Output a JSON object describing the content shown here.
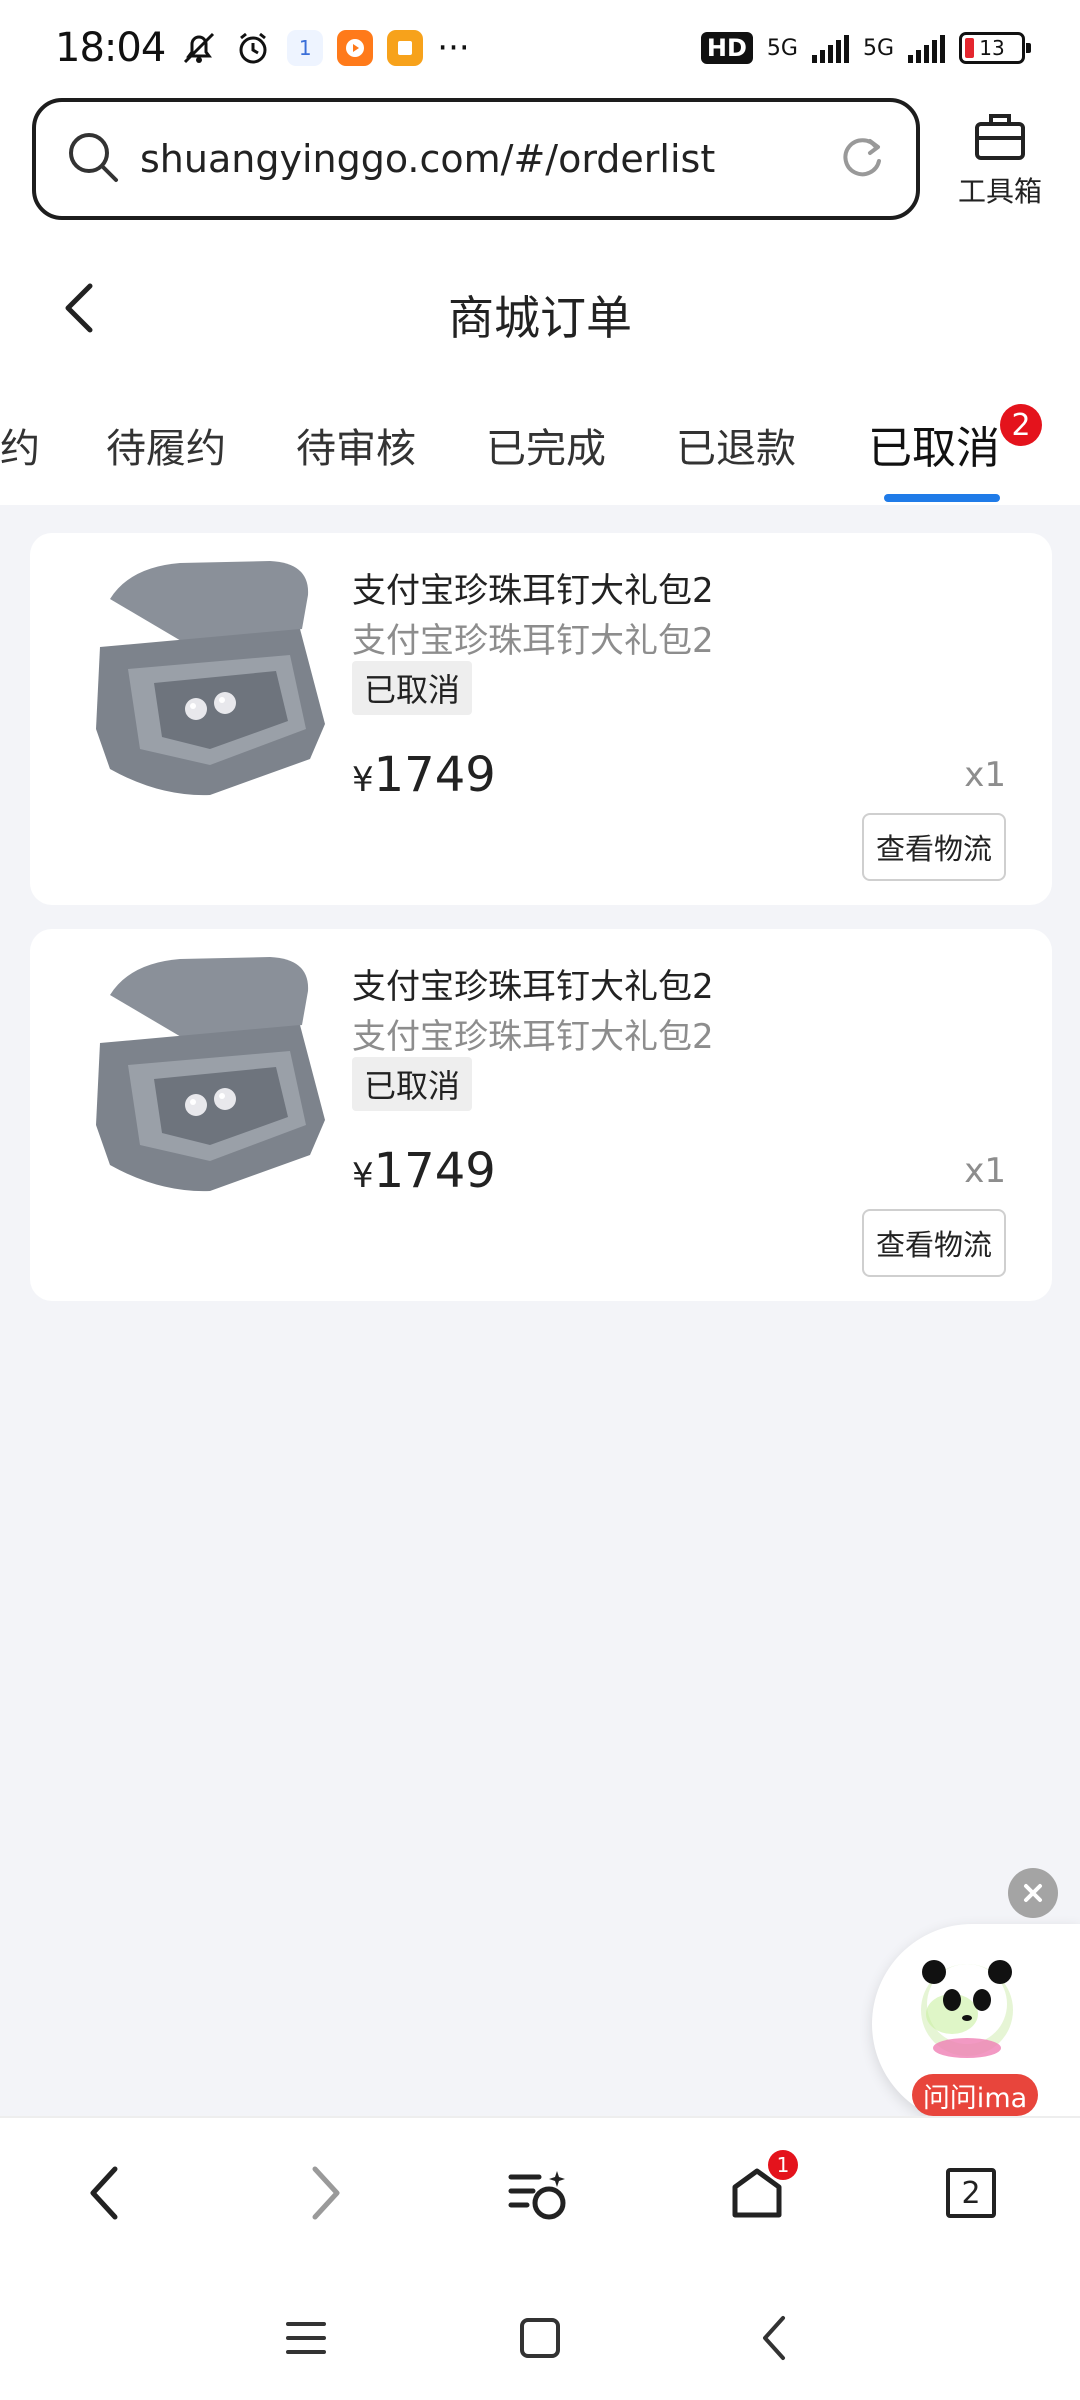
{
  "status_bar": {
    "time": "18:04",
    "notification_count": "1",
    "hd_label": "HD",
    "network1": "5G",
    "network2": "5G",
    "battery": "13"
  },
  "browser": {
    "url": "shuangyinggo.com/#/orderlist",
    "toolbox_label": "工具箱"
  },
  "header": {
    "title": "商城订单"
  },
  "tabs": [
    {
      "label": "约"
    },
    {
      "label": "待履约"
    },
    {
      "label": "待审核"
    },
    {
      "label": "已完成"
    },
    {
      "label": "已退款"
    },
    {
      "label": "已取消",
      "badge": "2",
      "active": true
    }
  ],
  "orders": [
    {
      "name": "支付宝珍珠耳钉大礼包2",
      "subtitle": "支付宝珍珠耳钉大礼包2",
      "status": "已取消",
      "currency": "¥",
      "price": "1749",
      "quantity": "x1",
      "action_label": "查看物流"
    },
    {
      "name": "支付宝珍珠耳钉大礼包2",
      "subtitle": "支付宝珍珠耳钉大礼包2",
      "status": "已取消",
      "currency": "¥",
      "price": "1749",
      "quantity": "x1",
      "action_label": "查看物流"
    }
  ],
  "floating": {
    "label": "问问ima"
  },
  "toolbar": {
    "home_badge": "1",
    "tabs_count": "2"
  },
  "colors": {
    "accent": "#1f7be8",
    "badge": "#e4131c",
    "background": "#f3f4f8"
  }
}
